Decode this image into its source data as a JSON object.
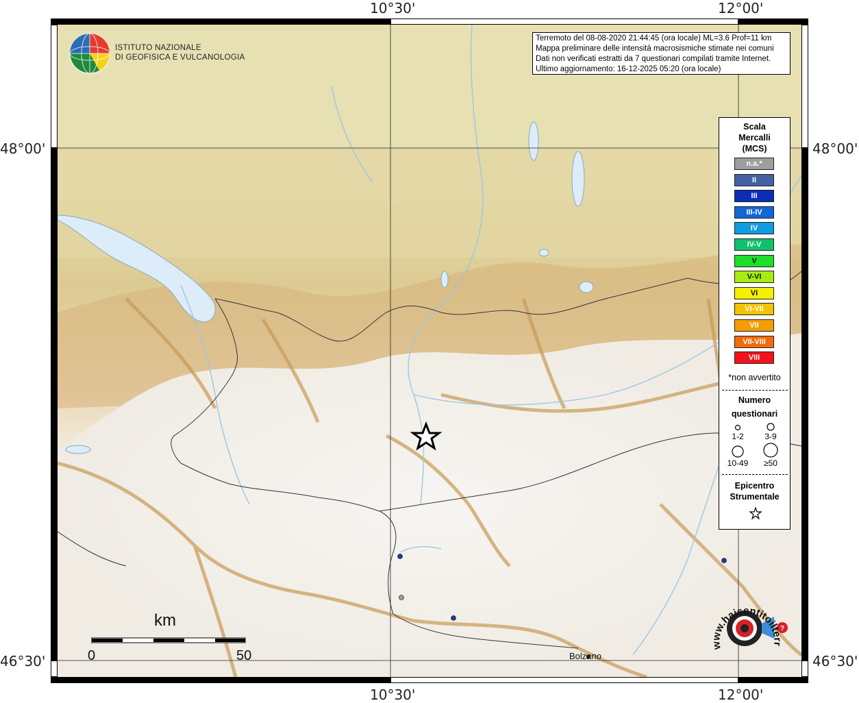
{
  "axes": {
    "top_left_lon": "10°30'",
    "top_right_lon": "12°00'",
    "bottom_left_lon": "10°30'",
    "bottom_right_lon": "12°00'",
    "left_upper_lat": "48°00'",
    "left_lower_lat": "46°30'",
    "right_upper_lat": "48°00'",
    "right_lower_lat": "46°30'"
  },
  "logo": {
    "line1": "ISTITUTO NAZIONALE",
    "line2": "DI GEOFISICA E VULCANOLOGIA"
  },
  "info": {
    "line1": "Terremoto del 08-08-2020 21:44:45 (ora locale) ML=3.6 Prof=11 km",
    "line2": "Mappa preliminare delle intensità macrosismiche stimate nei comuni",
    "line3": "Dati non verificati estratti da 7 questionari compilati tramite Internet.",
    "line4": "Ultimo aggiornamento: 16-12-2025 05:20 (ora locale)"
  },
  "legend": {
    "title1": "Scala",
    "title2": "Mercalli",
    "title3": "(MCS)",
    "scale": [
      {
        "label": "n.a.*",
        "color": "#9e9e9e"
      },
      {
        "label": "II",
        "color": "#4660a4"
      },
      {
        "label": "III",
        "color": "#0a2fb6"
      },
      {
        "label": "III-IV",
        "color": "#1466d6"
      },
      {
        "label": "IV",
        "color": "#119be0"
      },
      {
        "label": "IV-V",
        "color": "#11c06a"
      },
      {
        "label": "V",
        "color": "#1ede2a"
      },
      {
        "label": "V-VI",
        "color": "#a6ec10"
      },
      {
        "label": "VI",
        "color": "#f4f000"
      },
      {
        "label": "VI-VII",
        "color": "#f2c300"
      },
      {
        "label": "VII",
        "color": "#f59d00"
      },
      {
        "label": "VII-VIII",
        "color": "#f16b0e"
      },
      {
        "label": "VIII",
        "color": "#f0141a"
      }
    ],
    "footnote": "*non avvertito",
    "num_title1": "Numero",
    "num_title2": "questionari",
    "size_1_2": "1-2",
    "size_3_9": "3-9",
    "size_10_49": "10-49",
    "size_50": "≥50",
    "epi_title1": "Epicentro",
    "epi_title2": "Strumentale"
  },
  "scalebar": {
    "unit": "km",
    "zero": "0",
    "max": "50"
  },
  "places": {
    "bolzano": "Bolzano"
  },
  "watermark": {
    "text": "www.haisentitoilterremoto.it"
  },
  "colors": {
    "epicenter_star": "#000000",
    "felt_point": "#1c3ca0",
    "not_felt_point": "#9e9e9e",
    "lake": "#dcecf8",
    "border": "#333333"
  }
}
